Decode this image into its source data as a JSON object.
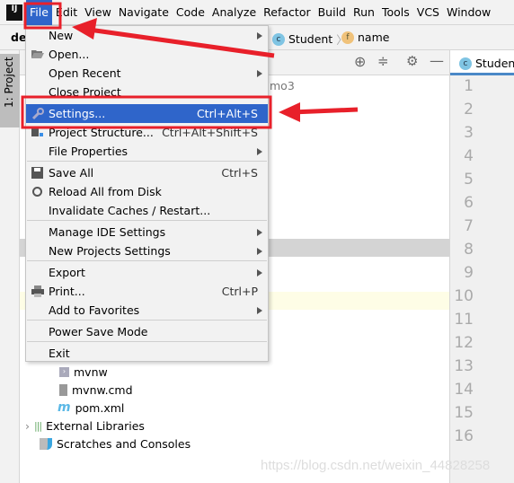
{
  "menubar": {
    "items": [
      "File",
      "Edit",
      "View",
      "Navigate",
      "Code",
      "Analyze",
      "Refactor",
      "Build",
      "Run",
      "Tools",
      "VCS",
      "Window"
    ],
    "logo": "IJ"
  },
  "navbar": {
    "project_fragment": "de",
    "crumbs": [
      {
        "icon": "class-icon",
        "glyph": "c",
        "label": "Student"
      },
      {
        "icon": "field-icon",
        "glyph": "f",
        "label": "name"
      }
    ]
  },
  "left_strip": {
    "project_tab": "1: Project"
  },
  "project_panel": {
    "root_fragment": "mo3",
    "tree": [
      {
        "label": "mvnw",
        "icon": "script-icon"
      },
      {
        "label": "mvnw.cmd",
        "icon": "text-file-icon"
      },
      {
        "label": "pom.xml",
        "icon": "maven-icon"
      },
      {
        "label": "External Libraries",
        "icon": "library-icon"
      },
      {
        "label": "Scratches and Consoles",
        "icon": "scratches-icon"
      }
    ]
  },
  "editor": {
    "tab": "Student",
    "line_numbers": [
      "1",
      "2",
      "3",
      "4",
      "5",
      "6",
      "7",
      "8",
      "9",
      "10",
      "11",
      "12",
      "13",
      "14",
      "15",
      "16"
    ]
  },
  "file_menu": {
    "items": [
      {
        "label": "New",
        "arrow": true
      },
      {
        "label": "Open...",
        "icon": "folder-open-icon"
      },
      {
        "label": "Open Recent",
        "arrow": true
      },
      {
        "label": "Close Project"
      },
      {
        "label": "Settings...",
        "shortcut": "Ctrl+Alt+S",
        "icon": "wrench-icon",
        "highlighted": true
      },
      {
        "label": "Project Structure...",
        "shortcut": "Ctrl+Alt+Shift+S",
        "icon": "project-structure-icon"
      },
      {
        "label": "File Properties",
        "arrow": true
      },
      {
        "label": "Save All",
        "shortcut": "Ctrl+S",
        "icon": "save-icon"
      },
      {
        "label": "Reload All from Disk",
        "icon": "reload-icon"
      },
      {
        "label": "Invalidate Caches / Restart..."
      },
      {
        "label": "Manage IDE Settings",
        "arrow": true
      },
      {
        "label": "New Projects Settings",
        "arrow": true
      },
      {
        "label": "Export",
        "arrow": true
      },
      {
        "label": "Print...",
        "shortcut": "Ctrl+P",
        "icon": "print-icon"
      },
      {
        "label": "Add to Favorites",
        "arrow": true
      },
      {
        "label": "Power Save Mode"
      },
      {
        "label": "Exit"
      }
    ]
  },
  "watermark": "https://blog.csdn.net/weixin_44828258",
  "colors": {
    "accent": "#2f65ca",
    "annotation": "#e8202a"
  }
}
